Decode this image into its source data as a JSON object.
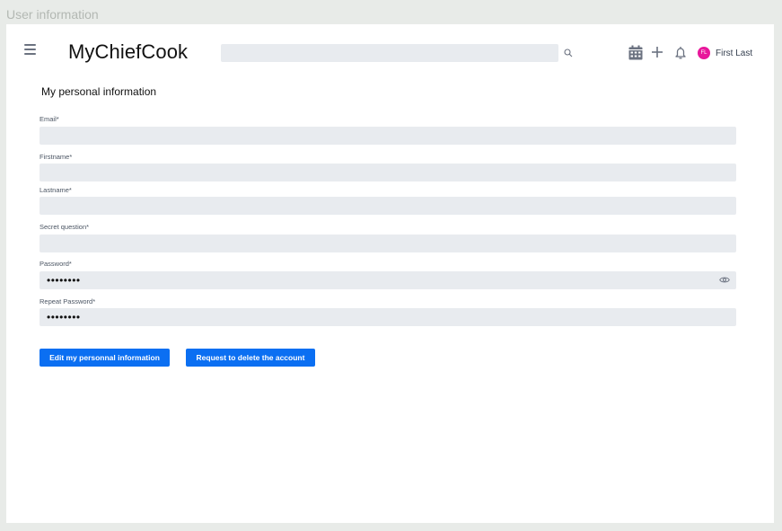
{
  "frame": {
    "label": "User information"
  },
  "header": {
    "brand": "MyChiefCook",
    "search": {
      "value": "",
      "placeholder": ""
    },
    "icons": [
      "menu-icon",
      "search-icon",
      "calendar-icon",
      "plus-icon",
      "bell-icon"
    ],
    "user": {
      "initials": "FL",
      "name": "First Last",
      "avatar_color": "#e8179b"
    }
  },
  "main": {
    "title": "My personal information",
    "fields": [
      {
        "label": "Email*",
        "value": "",
        "type": "text"
      },
      {
        "label": "Firstname*",
        "value": "",
        "type": "text"
      },
      {
        "label": "Lastname*",
        "value": "",
        "type": "text"
      },
      {
        "label": "Secret question*",
        "value": "",
        "type": "text"
      },
      {
        "label": "Password*",
        "value": "••••••••",
        "type": "password",
        "icon": "eye-icon"
      },
      {
        "label": "Repeat Password*",
        "value": "••••••••",
        "type": "password"
      }
    ],
    "buttons": {
      "edit_label": "Edit my personnal information",
      "delete_label": "Request to delete the account"
    }
  },
  "colors": {
    "accent": "#0b6ff2",
    "input_bg": "#e8ebef",
    "page_bg": "#e8ebe8"
  }
}
